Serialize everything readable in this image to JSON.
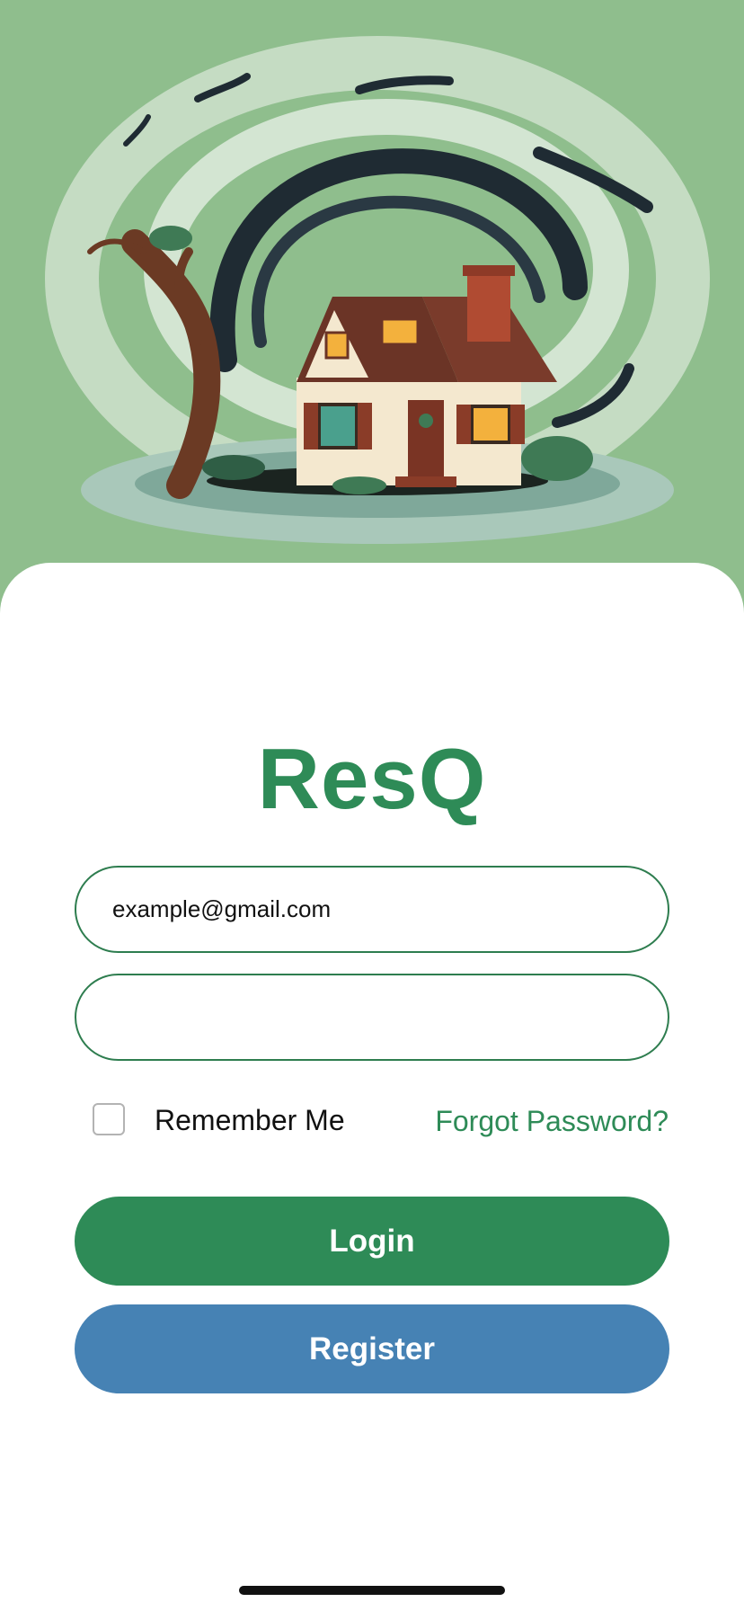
{
  "app": {
    "title": "ResQ"
  },
  "login_form": {
    "email_value": "example@gmail.com",
    "password_value": "",
    "remember_label": "Remember Me",
    "remember_checked": false,
    "forgot_label": "Forgot Password?"
  },
  "buttons": {
    "login_label": "Login",
    "register_label": "Register"
  },
  "colors": {
    "accent_green": "#2e8b57",
    "register_blue": "#4682b4",
    "hero_background": "#8fbe8d"
  }
}
